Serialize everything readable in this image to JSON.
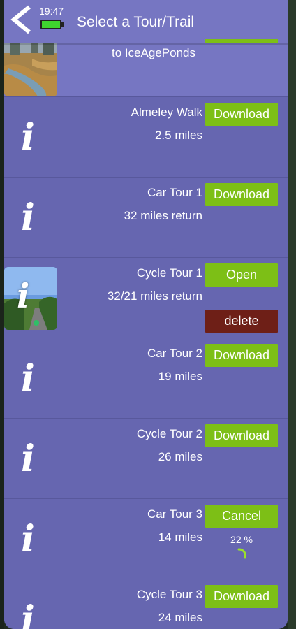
{
  "status": {
    "time": "19:47"
  },
  "header": {
    "title": "Select a Tour/Trail"
  },
  "partial_item": {
    "subtitle": "to IceAgePonds"
  },
  "items": [
    {
      "name": "Almeley Walk",
      "distance": "2.5 miles",
      "action": "Download"
    },
    {
      "name": "Car Tour 1",
      "distance": "32 miles return",
      "action": "Download"
    },
    {
      "name": "Cycle Tour 1",
      "distance": "32/21 miles return",
      "action": "Open",
      "secondary_action": "delete"
    },
    {
      "name": "Car Tour 2",
      "distance": "19 miles",
      "action": "Download"
    },
    {
      "name": "Cycle Tour 2",
      "distance": "26 miles",
      "action": "Download"
    },
    {
      "name": "Car Tour 3",
      "distance": "14 miles",
      "action": "Cancel",
      "progress_label": "22 %",
      "progress": 22
    },
    {
      "name": "Cycle Tour 3",
      "distance": "24 miles",
      "action": "Download"
    }
  ],
  "colors": {
    "background": "#6666b0",
    "header": "#7676c2",
    "button": "#7dbf16",
    "delete_button": "#6e1f17"
  },
  "icons": {
    "back": "chevron-left-icon",
    "info": "info-icon"
  }
}
